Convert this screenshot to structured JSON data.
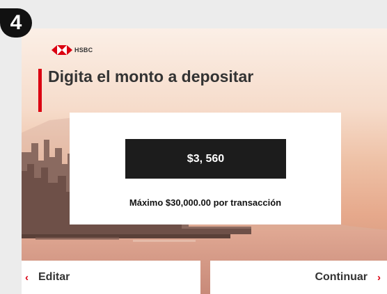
{
  "step": {
    "number": "4"
  },
  "brand": {
    "name": "HSBC",
    "colors": {
      "primary_red": "#db0011",
      "text_dark": "#333333"
    }
  },
  "page": {
    "title": "Digita el monto a depositar"
  },
  "amount": {
    "value": "$3, 560",
    "limit_note": "Máximo $30,000.00 por transacción"
  },
  "actions": {
    "back_label": "Editar",
    "back_icon": "chevron-left-icon",
    "next_label": "Continuar",
    "next_icon": "chevron-right-icon"
  }
}
